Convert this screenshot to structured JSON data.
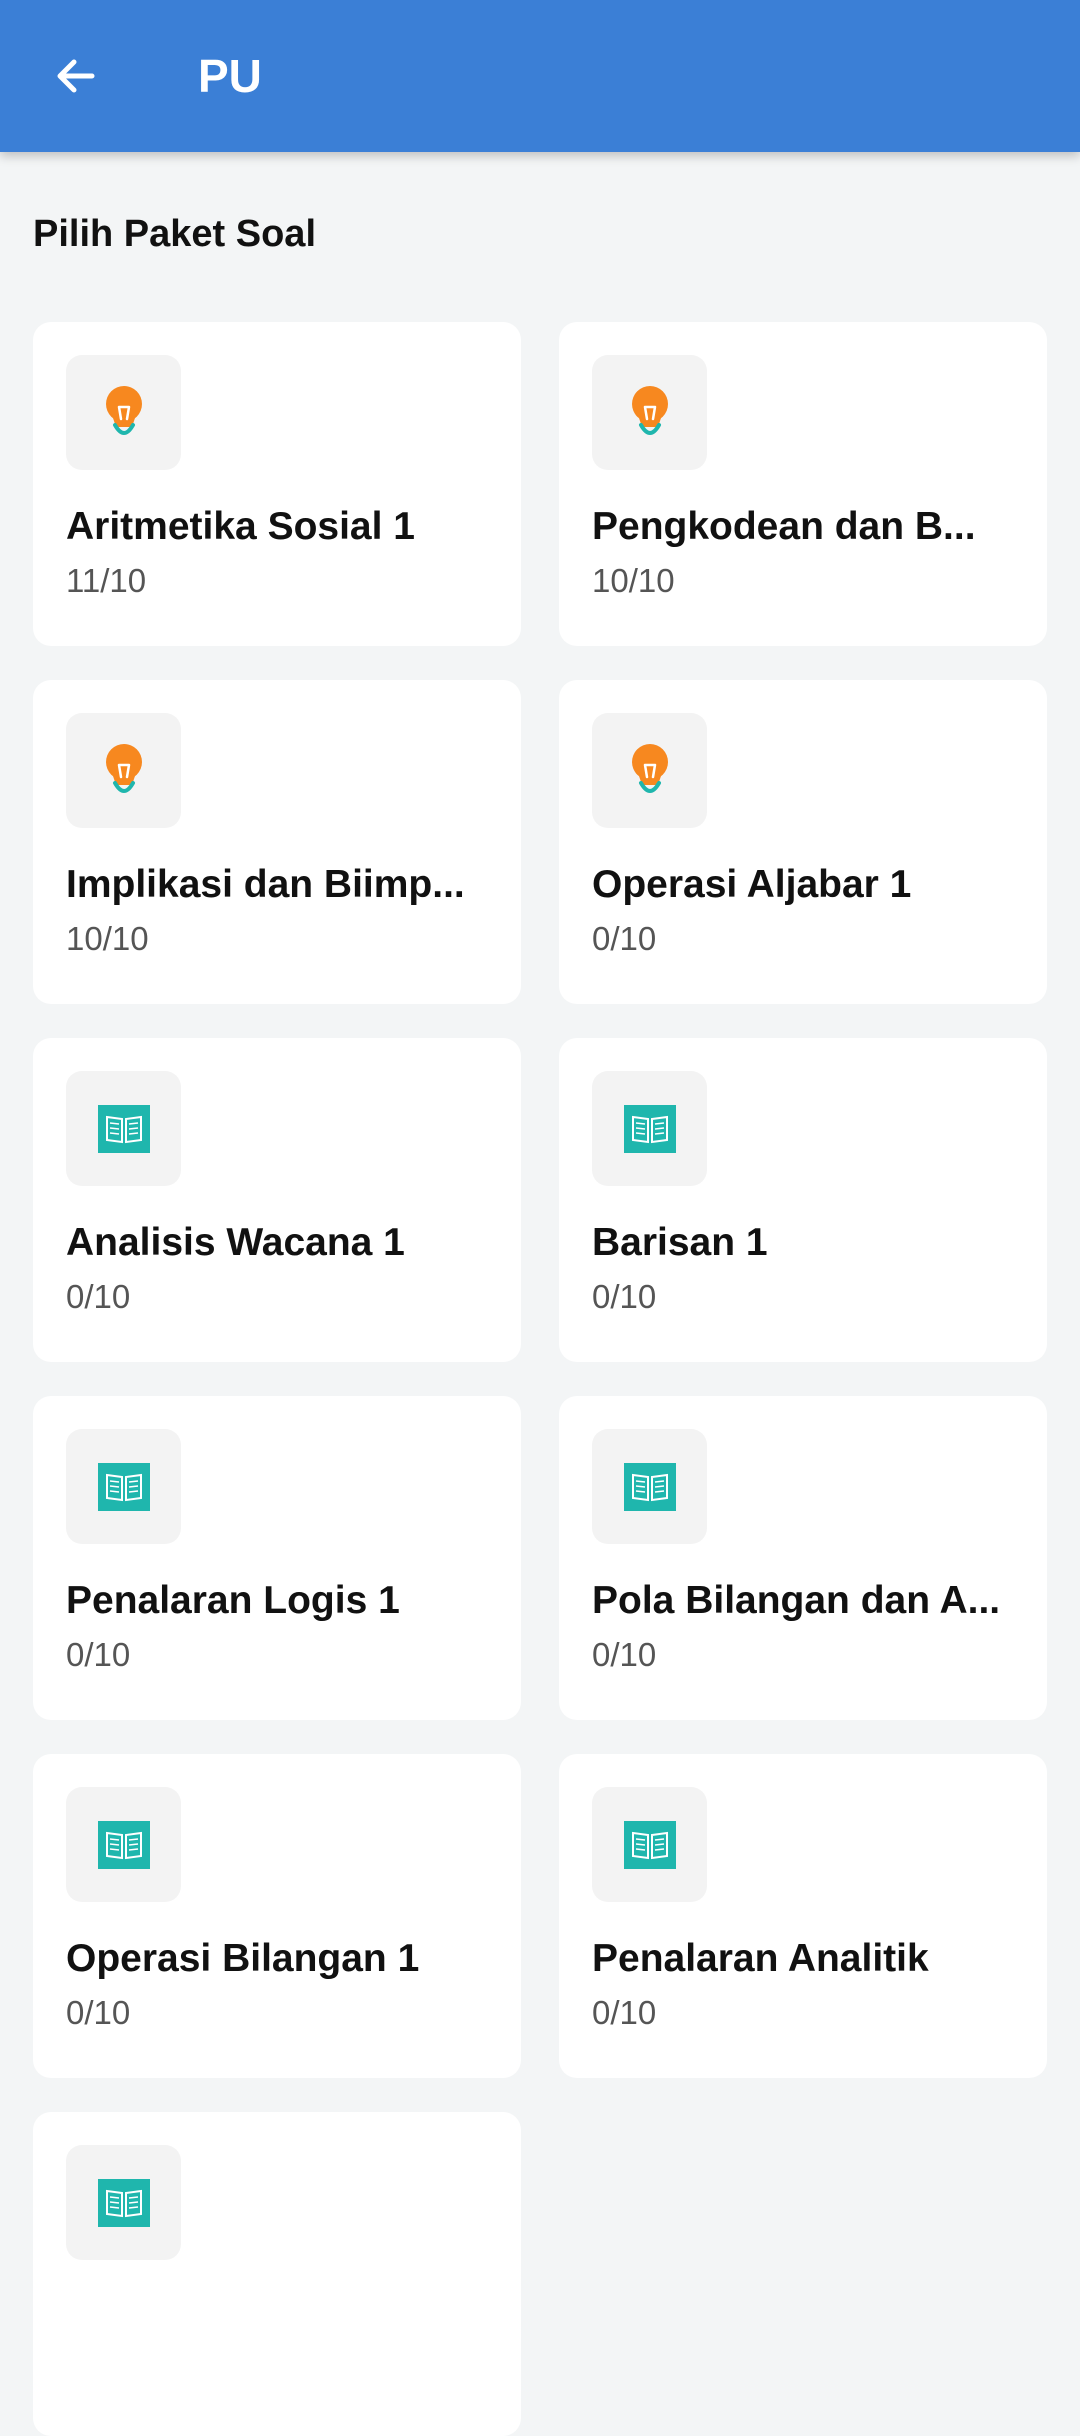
{
  "appbar": {
    "title": "PU",
    "back_icon": "arrow-left-icon",
    "color": "#3b7fd6"
  },
  "section_title": "Pilih Paket Soal",
  "packages": [
    {
      "title": "Aritmetika Sosial 1",
      "progress": "11/10",
      "icon": "lightbulb-icon"
    },
    {
      "title": "Pengkodean dan B...",
      "progress": "10/10",
      "icon": "lightbulb-icon"
    },
    {
      "title": "Implikasi dan Biimp...",
      "progress": "10/10",
      "icon": "lightbulb-icon"
    },
    {
      "title": "Operasi Aljabar 1",
      "progress": "0/10",
      "icon": "lightbulb-icon"
    },
    {
      "title": "Analisis Wacana 1",
      "progress": "0/10",
      "icon": "book-icon"
    },
    {
      "title": "Barisan 1",
      "progress": "0/10",
      "icon": "book-icon"
    },
    {
      "title": "Penalaran Logis 1",
      "progress": "0/10",
      "icon": "book-icon"
    },
    {
      "title": "Pola Bilangan dan A...",
      "progress": "0/10",
      "icon": "book-icon"
    },
    {
      "title": "Operasi Bilangan 1",
      "progress": "0/10",
      "icon": "book-icon"
    },
    {
      "title": "Penalaran Analitik",
      "progress": "0/10",
      "icon": "book-icon"
    },
    {
      "title": "",
      "progress": "",
      "icon": "book-icon"
    }
  ]
}
